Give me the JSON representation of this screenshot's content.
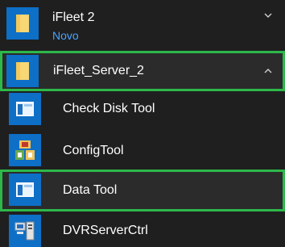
{
  "groups": [
    {
      "title": "iFleet 2",
      "subtitle": "Novo",
      "state_icon": "chevron-down-icon"
    },
    {
      "title": "iFleet_Server_2",
      "state_icon": "chevron-up-icon"
    }
  ],
  "apps": [
    {
      "label": "Check Disk Tool",
      "icon": "window-icon"
    },
    {
      "label": "ConfigTool",
      "icon": "config-app-icon"
    },
    {
      "label": "Data Tool",
      "icon": "window-icon"
    },
    {
      "label": "DVRServerCtrl",
      "icon": "server-app-icon"
    }
  ],
  "colors": {
    "background": "#1f1f1f",
    "tile": "#0e6fc7",
    "highlight": "#2db84a",
    "subtitle": "#4aa3ff",
    "folder": "#f8d775"
  }
}
